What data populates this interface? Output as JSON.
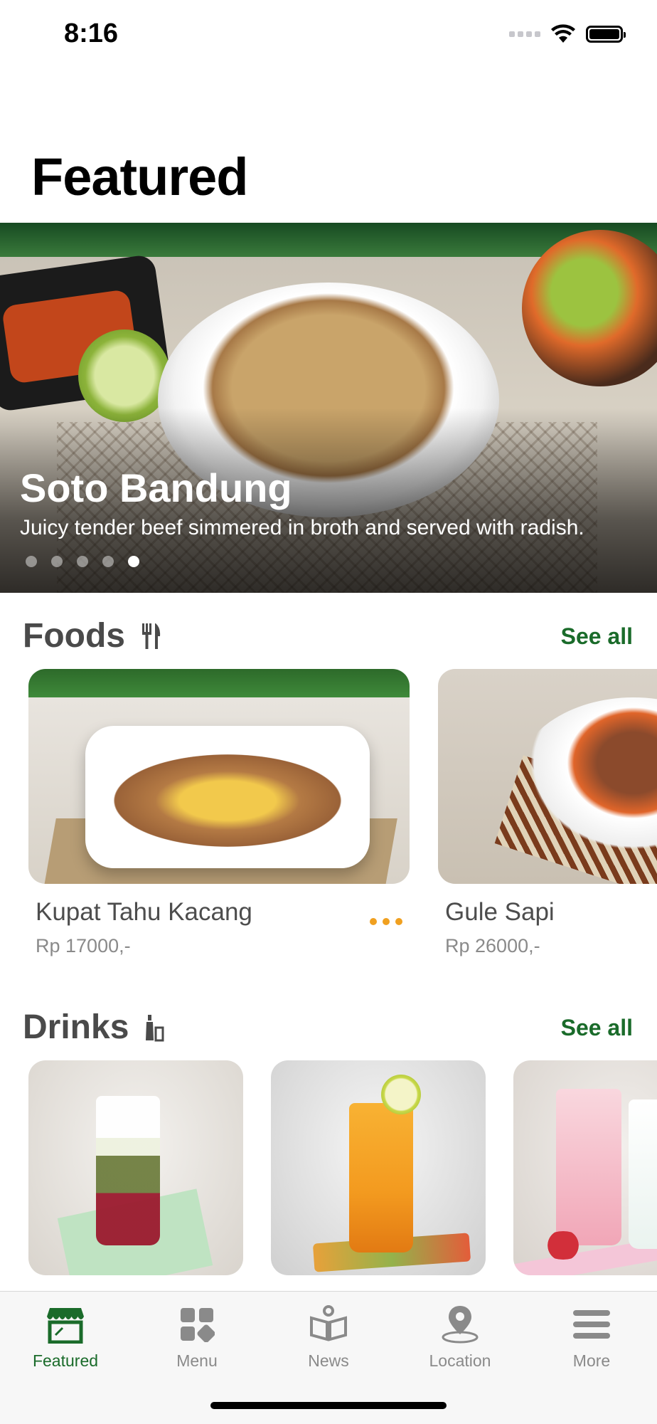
{
  "status_bar": {
    "time": "8:16"
  },
  "page": {
    "title": "Featured"
  },
  "hero": {
    "title": "Soto Bandung",
    "description": "Juicy tender beef simmered in broth and served with radish.",
    "slide_count": 5,
    "active_slide": 5
  },
  "foods": {
    "title": "Foods",
    "icon": "utensils-icon",
    "see_all": "See all",
    "items": [
      {
        "name": "Kupat Tahu Kacang",
        "price": "Rp 17000,-"
      },
      {
        "name": "Gule Sapi",
        "price": "Rp 26000,-"
      }
    ]
  },
  "drinks": {
    "title": "Drinks",
    "icon": "bottle-glass-icon",
    "see_all": "See all"
  },
  "tabs": [
    {
      "label": "Featured",
      "icon": "storefront-icon",
      "active": true
    },
    {
      "label": "Menu",
      "icon": "grid-menu-icon",
      "active": false
    },
    {
      "label": "News",
      "icon": "news-book-icon",
      "active": false
    },
    {
      "label": "Location",
      "icon": "location-pin-icon",
      "active": false
    },
    {
      "label": "More",
      "icon": "hamburger-menu-icon",
      "active": false
    }
  ],
  "colors": {
    "accent": "#1a6b2a",
    "inactive_tab": "#8a8a8a",
    "more_dots": "#f0a020"
  }
}
